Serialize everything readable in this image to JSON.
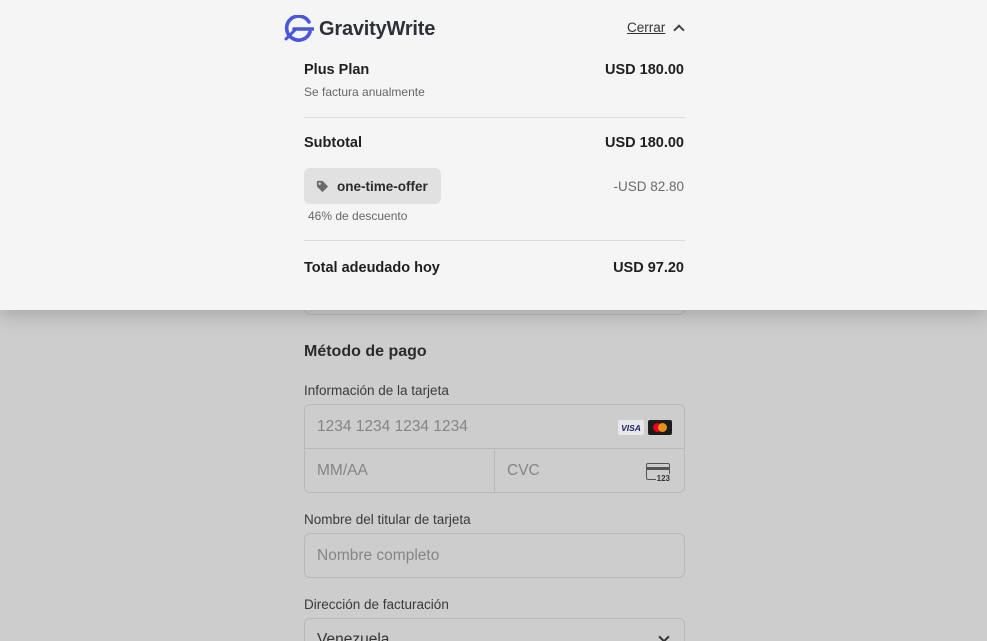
{
  "brand": {
    "name": "GravityWrite",
    "color": "#4a57d9"
  },
  "summary": {
    "close_label": "Cerrar",
    "plan_name": "Plus Plan",
    "plan_amount": "USD 180.00",
    "billing_note": "Se factura anualmente",
    "subtotal_label": "Subtotal",
    "subtotal_amount": "USD 180.00",
    "promo_code": "one-time-offer",
    "discount_amount": "-USD 82.80",
    "discount_note": "46% de descuento",
    "total_label": "Total adeudado hoy",
    "total_amount": "USD 97.20"
  },
  "payment": {
    "section_title": "Método de pago",
    "card_label": "Información de la tarjeta",
    "card_number_placeholder": "1234 1234 1234 1234",
    "expiry_placeholder": "MM/AA",
    "cvc_placeholder": "CVC",
    "cvc_icon_text": "123",
    "visa_text": "VISA",
    "cardholder_label": "Nombre del titular de tarjeta",
    "cardholder_placeholder": "Nombre completo",
    "billing_label": "Dirección de facturación",
    "country_value": "Venezuela"
  },
  "icons": [
    "gravitywrite-logo-icon",
    "chevron-up-icon",
    "tag-icon",
    "visa-icon",
    "mastercard-icon",
    "cvc-card-icon",
    "chevron-down-icon"
  ]
}
